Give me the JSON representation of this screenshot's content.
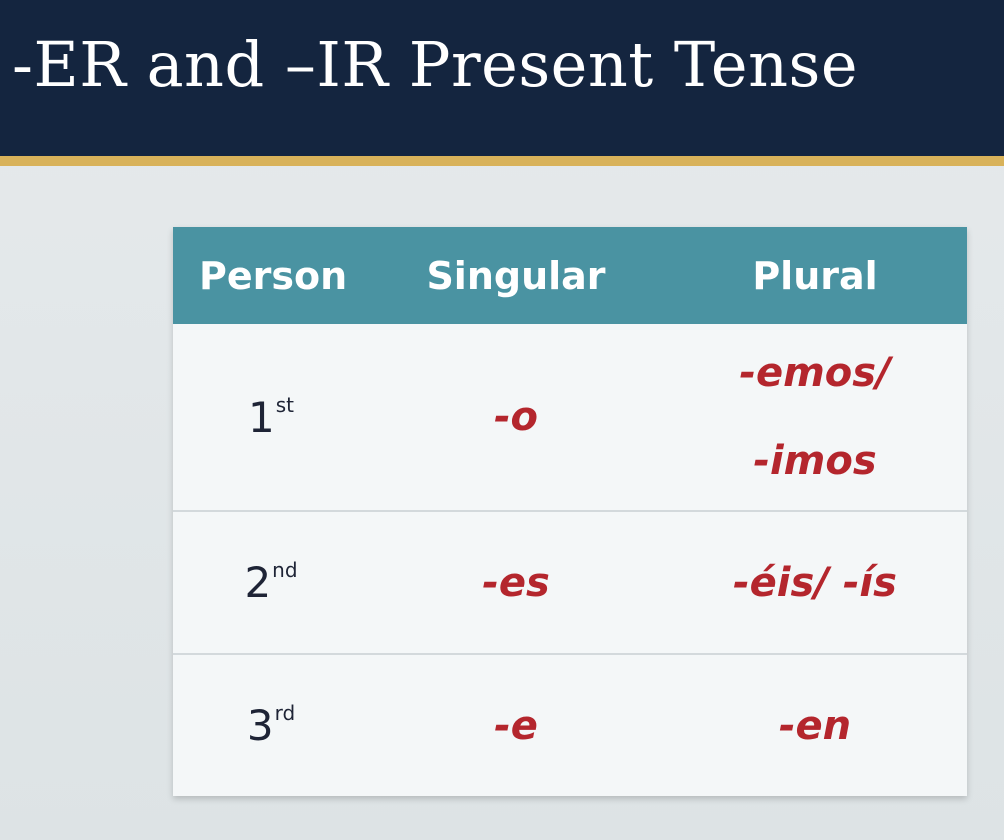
{
  "slide": {
    "title": "-ER and –IR Present Tense"
  },
  "colors": {
    "title_bar": "#14253f",
    "title_underline": "#d8b25a",
    "header_row": "#4a93a2",
    "ending_text": "#b4262d",
    "cell_background": "#f4f7f8"
  },
  "table": {
    "headers": [
      "Person",
      "Singular",
      "Plural"
    ],
    "rows": [
      {
        "person_number": "1",
        "person_suffix": "st",
        "singular": "-o",
        "plural_line1": "-emos/",
        "plural_line2": "-imos"
      },
      {
        "person_number": "2",
        "person_suffix": "nd",
        "singular": "-es",
        "plural": "-éis/ -ís"
      },
      {
        "person_number": "3",
        "person_suffix": "rd",
        "singular": "-e",
        "plural": "-en"
      }
    ]
  }
}
